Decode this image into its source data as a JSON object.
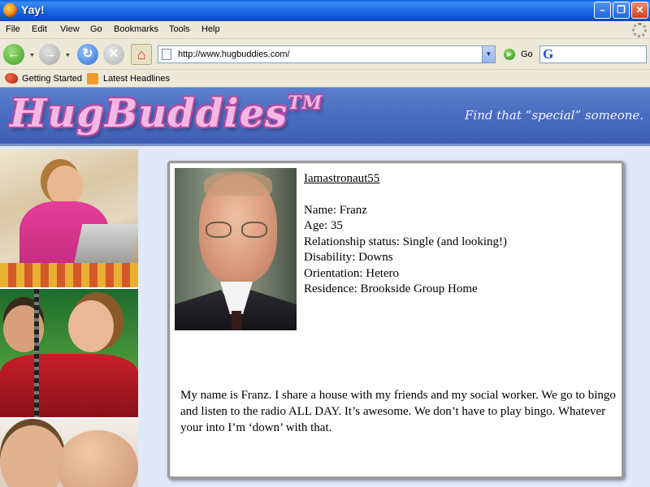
{
  "window": {
    "title": "Yay!"
  },
  "menu": {
    "items": [
      "File",
      "Edit",
      "View",
      "Go",
      "Bookmarks",
      "Tools",
      "Help"
    ]
  },
  "toolbar": {
    "back_icon": "back-arrow-icon",
    "forward_icon": "forward-arrow-icon",
    "reload_icon": "reload-icon",
    "stop_icon": "stop-icon",
    "home_icon": "home-icon",
    "url": "http://www.hugbuddies.com/",
    "go_label": "Go",
    "search_value": ""
  },
  "bookmarks": {
    "items": [
      "Getting Started",
      "Latest Headlines"
    ]
  },
  "site": {
    "logo": "HugBuddies",
    "logo_tm": "TM",
    "tagline": "Find that “special” someone."
  },
  "profile": {
    "username": "Iamastronaut55",
    "fields": [
      "Name: Franz",
      "Age: 35",
      "Relationship status: Single (and looking!)",
      "Disability: Downs",
      "Orientation: Hetero",
      "Residence: Brookside Group Home"
    ],
    "bio": "My name is Franz. I share a house with my friends and my social worker. We go to bingo and listen to the radio ALL DAY. It’s awesome. We don’t have to play bingo. Whatever your into I’m ‘down’ with that."
  }
}
